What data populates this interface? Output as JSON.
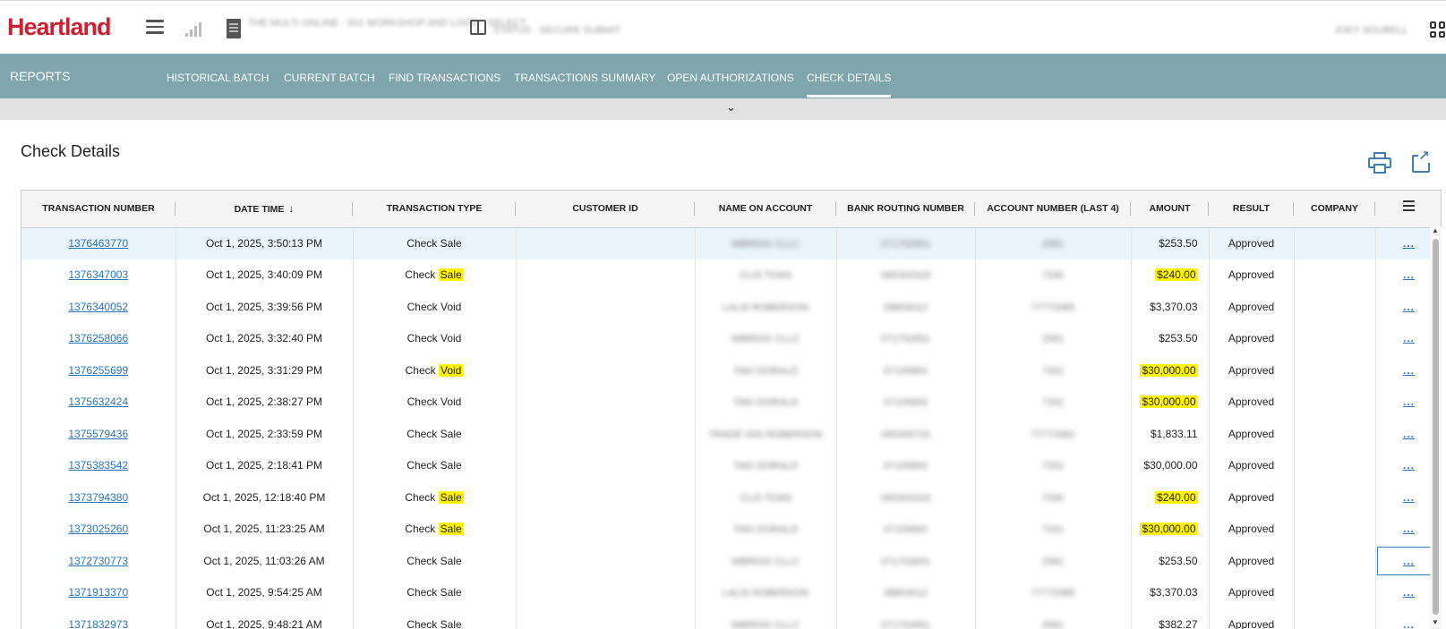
{
  "header": {
    "logo": "Heartland",
    "location_text": "THE MULTI ONLINE · 001 WORKSHOP AND LOGO · SELECT",
    "status_text": "STATUS · SECURE SUBMIT",
    "user_text": "JOEY SOUBELL"
  },
  "nav": {
    "title": "REPORTS",
    "tabs": [
      {
        "label": "HISTORICAL BATCH"
      },
      {
        "label": "CURRENT BATCH"
      },
      {
        "label": "FIND TRANSACTIONS"
      },
      {
        "label": "TRANSACTIONS SUMMARY"
      },
      {
        "label": "OPEN AUTHORIZATIONS"
      },
      {
        "label": "CHECK DETAILS",
        "active": true
      }
    ]
  },
  "page": {
    "title": "Check Details"
  },
  "table": {
    "columns": [
      "TRANSACTION NUMBER",
      "DATE TIME",
      "TRANSACTION TYPE",
      "CUSTOMER ID",
      "NAME ON ACCOUNT",
      "BANK ROUTING NUMBER",
      "ACCOUNT NUMBER (LAST 4)",
      "AMOUNT",
      "RESULT",
      "COMPANY"
    ],
    "sort_indicator": "↓",
    "row_action_label": "...",
    "rows": [
      {
        "txn": "1376463770",
        "date": "Oct 1, 2025, 3:50:13 PM",
        "type_a": "Check",
        "type_b": "Sale",
        "type_hl": false,
        "customer": "",
        "name": "WBRDIG CLLC",
        "routing": "071702651",
        "acct": "2581",
        "amount": "$253.50",
        "amount_hl": false,
        "result": "Approved",
        "company": ""
      },
      {
        "txn": "1376347003",
        "date": "Oct 1, 2025, 3:40:09 PM",
        "type_a": "Check",
        "type_b": "Sale",
        "type_hl": true,
        "customer": "",
        "name": "CLIS TOAN",
        "routing": "065303318",
        "acct": "7330",
        "amount": "$240.00",
        "amount_hl": true,
        "result": "Approved",
        "company": ""
      },
      {
        "txn": "1376340052",
        "date": "Oct 1, 2025, 3:39:56 PM",
        "type_a": "Check",
        "type_b": "Void",
        "type_hl": false,
        "customer": "",
        "name": "LALIS ROBERSON",
        "routing": "08803012",
        "acct": "77773385",
        "amount": "$3,370.03",
        "amount_hl": false,
        "result": "Approved",
        "company": ""
      },
      {
        "txn": "1376258066",
        "date": "Oct 1, 2025, 3:32:40 PM",
        "type_a": "Check",
        "type_b": "Void",
        "type_hl": false,
        "customer": "",
        "name": "WBRDIG CLLC",
        "routing": "071702651",
        "acct": "2581",
        "amount": "$253.50",
        "amount_hl": false,
        "result": "Approved",
        "company": ""
      },
      {
        "txn": "1376255699",
        "date": "Oct 1, 2025, 3:31:29 PM",
        "type_a": "Check",
        "type_b": "Void",
        "type_hl": true,
        "customer": "",
        "name": "TAKI DORALD",
        "routing": "07105800",
        "acct": "7331",
        "amount": "$30,000.00",
        "amount_hl": true,
        "result": "Approved",
        "company": ""
      },
      {
        "txn": "1375632424",
        "date": "Oct 1, 2025, 2:38:27 PM",
        "type_a": "Check",
        "type_b": "Void",
        "type_hl": false,
        "customer": "",
        "name": "TAKI DORALD",
        "routing": "07105800",
        "acct": "7331",
        "amount": "$30,000.00",
        "amount_hl": true,
        "result": "Approved",
        "company": ""
      },
      {
        "txn": "1375579436",
        "date": "Oct 1, 2025, 2:33:59 PM",
        "type_a": "Check",
        "type_b": "Sale",
        "type_hl": false,
        "customer": "",
        "name": "TRADE ISIS ROBERSON",
        "routing": "065305715",
        "acct": "77773382",
        "amount": "$1,833.11",
        "amount_hl": false,
        "result": "Approved",
        "company": ""
      },
      {
        "txn": "1375383542",
        "date": "Oct 1, 2025, 2:18:41 PM",
        "type_a": "Check",
        "type_b": "Sale",
        "type_hl": false,
        "customer": "",
        "name": "TAKI DORALD",
        "routing": "07105800",
        "acct": "7331",
        "amount": "$30,000.00",
        "amount_hl": false,
        "result": "Approved",
        "company": ""
      },
      {
        "txn": "1373794380",
        "date": "Oct 1, 2025, 12:18:40 PM",
        "type_a": "Check",
        "type_b": "Sale",
        "type_hl": true,
        "customer": "",
        "name": "CLIS TOAN",
        "routing": "065303318",
        "acct": "7330",
        "amount": "$240.00",
        "amount_hl": true,
        "result": "Approved",
        "company": ""
      },
      {
        "txn": "1373025260",
        "date": "Oct 1, 2025, 11:23:25 AM",
        "type_a": "Check",
        "type_b": "Sale",
        "type_hl": true,
        "customer": "",
        "name": "TAKI DORALD",
        "routing": "07105800",
        "acct": "7331",
        "amount": "$30,000.00",
        "amount_hl": true,
        "result": "Approved",
        "company": ""
      },
      {
        "txn": "1372730773",
        "date": "Oct 1, 2025, 11:03:26 AM",
        "type_a": "Check",
        "type_b": "Sale",
        "type_hl": false,
        "customer": "",
        "name": "WBRDIG CLLC",
        "routing": "071702651",
        "acct": "2581",
        "amount": "$253.50",
        "amount_hl": false,
        "result": "Approved",
        "company": ""
      },
      {
        "txn": "1371913370",
        "date": "Oct 1, 2025, 9:54:25 AM",
        "type_a": "Check",
        "type_b": "Sale",
        "type_hl": false,
        "customer": "",
        "name": "LALIS ROBERSON",
        "routing": "08803012",
        "acct": "77773385",
        "amount": "$3,370.03",
        "amount_hl": false,
        "result": "Approved",
        "company": ""
      },
      {
        "txn": "1371832973",
        "date": "Oct 1, 2025, 9:48:21 AM",
        "type_a": "Check",
        "type_b": "Sale",
        "type_hl": false,
        "customer": "",
        "name": "WBRDIG CLLC",
        "routing": "071702651",
        "acct": "4581",
        "amount": "$382.27",
        "amount_hl": false,
        "result": "Approved",
        "company": ""
      }
    ]
  }
}
